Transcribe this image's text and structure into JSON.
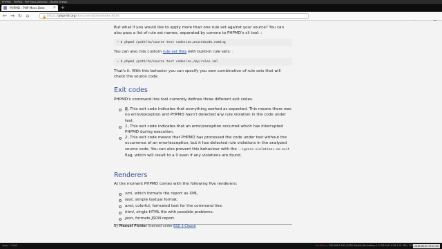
{
  "window": {
    "title": "PHPMD - PHP Mess Detector - Mozilla Firefox",
    "wm_label": "PHPMD"
  },
  "tab": {
    "title": "PHPMD - PHP Mess Dete",
    "close": "×"
  },
  "newtab": "+",
  "nav": {
    "back": "←",
    "forward": "→",
    "reload": "↻",
    "home": "⌂"
  },
  "url": {
    "scheme": "https://",
    "host": "phpmd.org",
    "path": "/documentation/index.html"
  },
  "tools": [
    "…",
    "☆",
    "⇩",
    "▥",
    "☰"
  ],
  "doc": {
    "intro": "But what if you would like to apply more than one rule set against your source? You can also pass a list of rule set names, separated by comma to PHPMD's cli tool: :",
    "code1": "~ $ phpmd /path/to/source text codesize,unusedcode,naming",
    "custom_pre": "You can also mix custom ",
    "custom_link": "rule set files",
    "custom_post": " with build-in rule sets: :",
    "code2": "~ $ phpmd /path/to/source text codesize,/my/rules.xml",
    "thats_it": "That's it. With this behavior you can specify you own combination of rule sets that will check the source code.",
    "exit_heading": "Exit codes",
    "exit_intro": "PHPMD's command line tool currently defines three different exit codes.",
    "exit_items": [
      {
        "code": "0",
        "text": ", This exit code indicates that everything worked as expected. This means there was no error/exception and PHPMD hasn't detected any rule violation in the code under test."
      },
      {
        "code": "1",
        "text": ", This exit code indicates that an error/exception occurred which has interrupted PHPMD during execution."
      },
      {
        "code": "2",
        "text": ", This exit code means that PHPMD has processed the code under test without the occurrence of an error/exception, but it has detected rule violations in the analyzed source code. You can also prevent this behaviour with the ",
        "flag": "--ignore-violations-on-exit",
        "tail": " flag, which will result to a 0 even if any violations are found."
      }
    ],
    "renderers_heading": "Renderers",
    "renderers_intro": "At the moment PHPMD comes with the following five renderers:",
    "renderers": [
      {
        "name": "xml",
        "text": ", which formats the report as XML."
      },
      {
        "name": "text",
        "text": ", simple textual format."
      },
      {
        "name": "ansi",
        "text": ", colorful, formated text for the command line."
      },
      {
        "name": "html",
        "text": ", single HTML file with possible problems."
      },
      {
        "name": "json",
        "text": ", formats JSON report."
      }
    ],
    "footer_by": "By ",
    "footer_author": "Manuel Pichler",
    "footer_mid": " licensed under ",
    "footer_license": "BSD 3-Clause"
  },
  "statusbar": {
    "left": "nbsp:~ 1:fd6",
    "right_red": "No Battery",
    "right": "192.168.1.163 (100% Mobile)  No battery  1.5 GiB  0.81  0.58  1.41 GiB | 115.9 GiB",
    "clock": "2018-08-04 13:21:20"
  },
  "colors": {
    "heading": "#34508f",
    "link": "#2653a6",
    "code_bg": "#ececec"
  }
}
